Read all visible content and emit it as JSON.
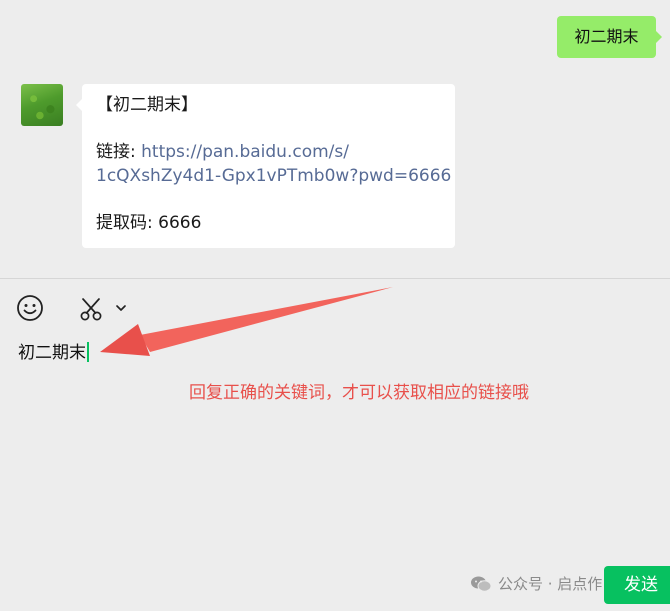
{
  "conversation": {
    "outgoing_message": "初二期末",
    "incoming_message": {
      "title": "【初二期末】",
      "link_prefix": "链接: ",
      "link_line1": "https://pan.baidu.com/s/",
      "link_line2": "1cQXshZy4d1-Gpx1vPTmb0w?pwd=6666",
      "code_label": "提取码: ",
      "code_value": "6666"
    }
  },
  "toolbar": {
    "icons": [
      "emoji-icon",
      "scissors-icon",
      "chevron-down-icon"
    ]
  },
  "input": {
    "value": "初二期末"
  },
  "annotation": {
    "text": "回复正确的关键词，才可以获取相应的链接哦",
    "color": "#e8504b"
  },
  "send_button": {
    "label": "发送"
  },
  "watermark": {
    "text": "公众号 · 启点作"
  },
  "colors": {
    "background": "#ededed",
    "outgoing_bubble": "#95ec69",
    "incoming_bubble": "#ffffff",
    "link": "#576b95",
    "send_button": "#07c160"
  }
}
